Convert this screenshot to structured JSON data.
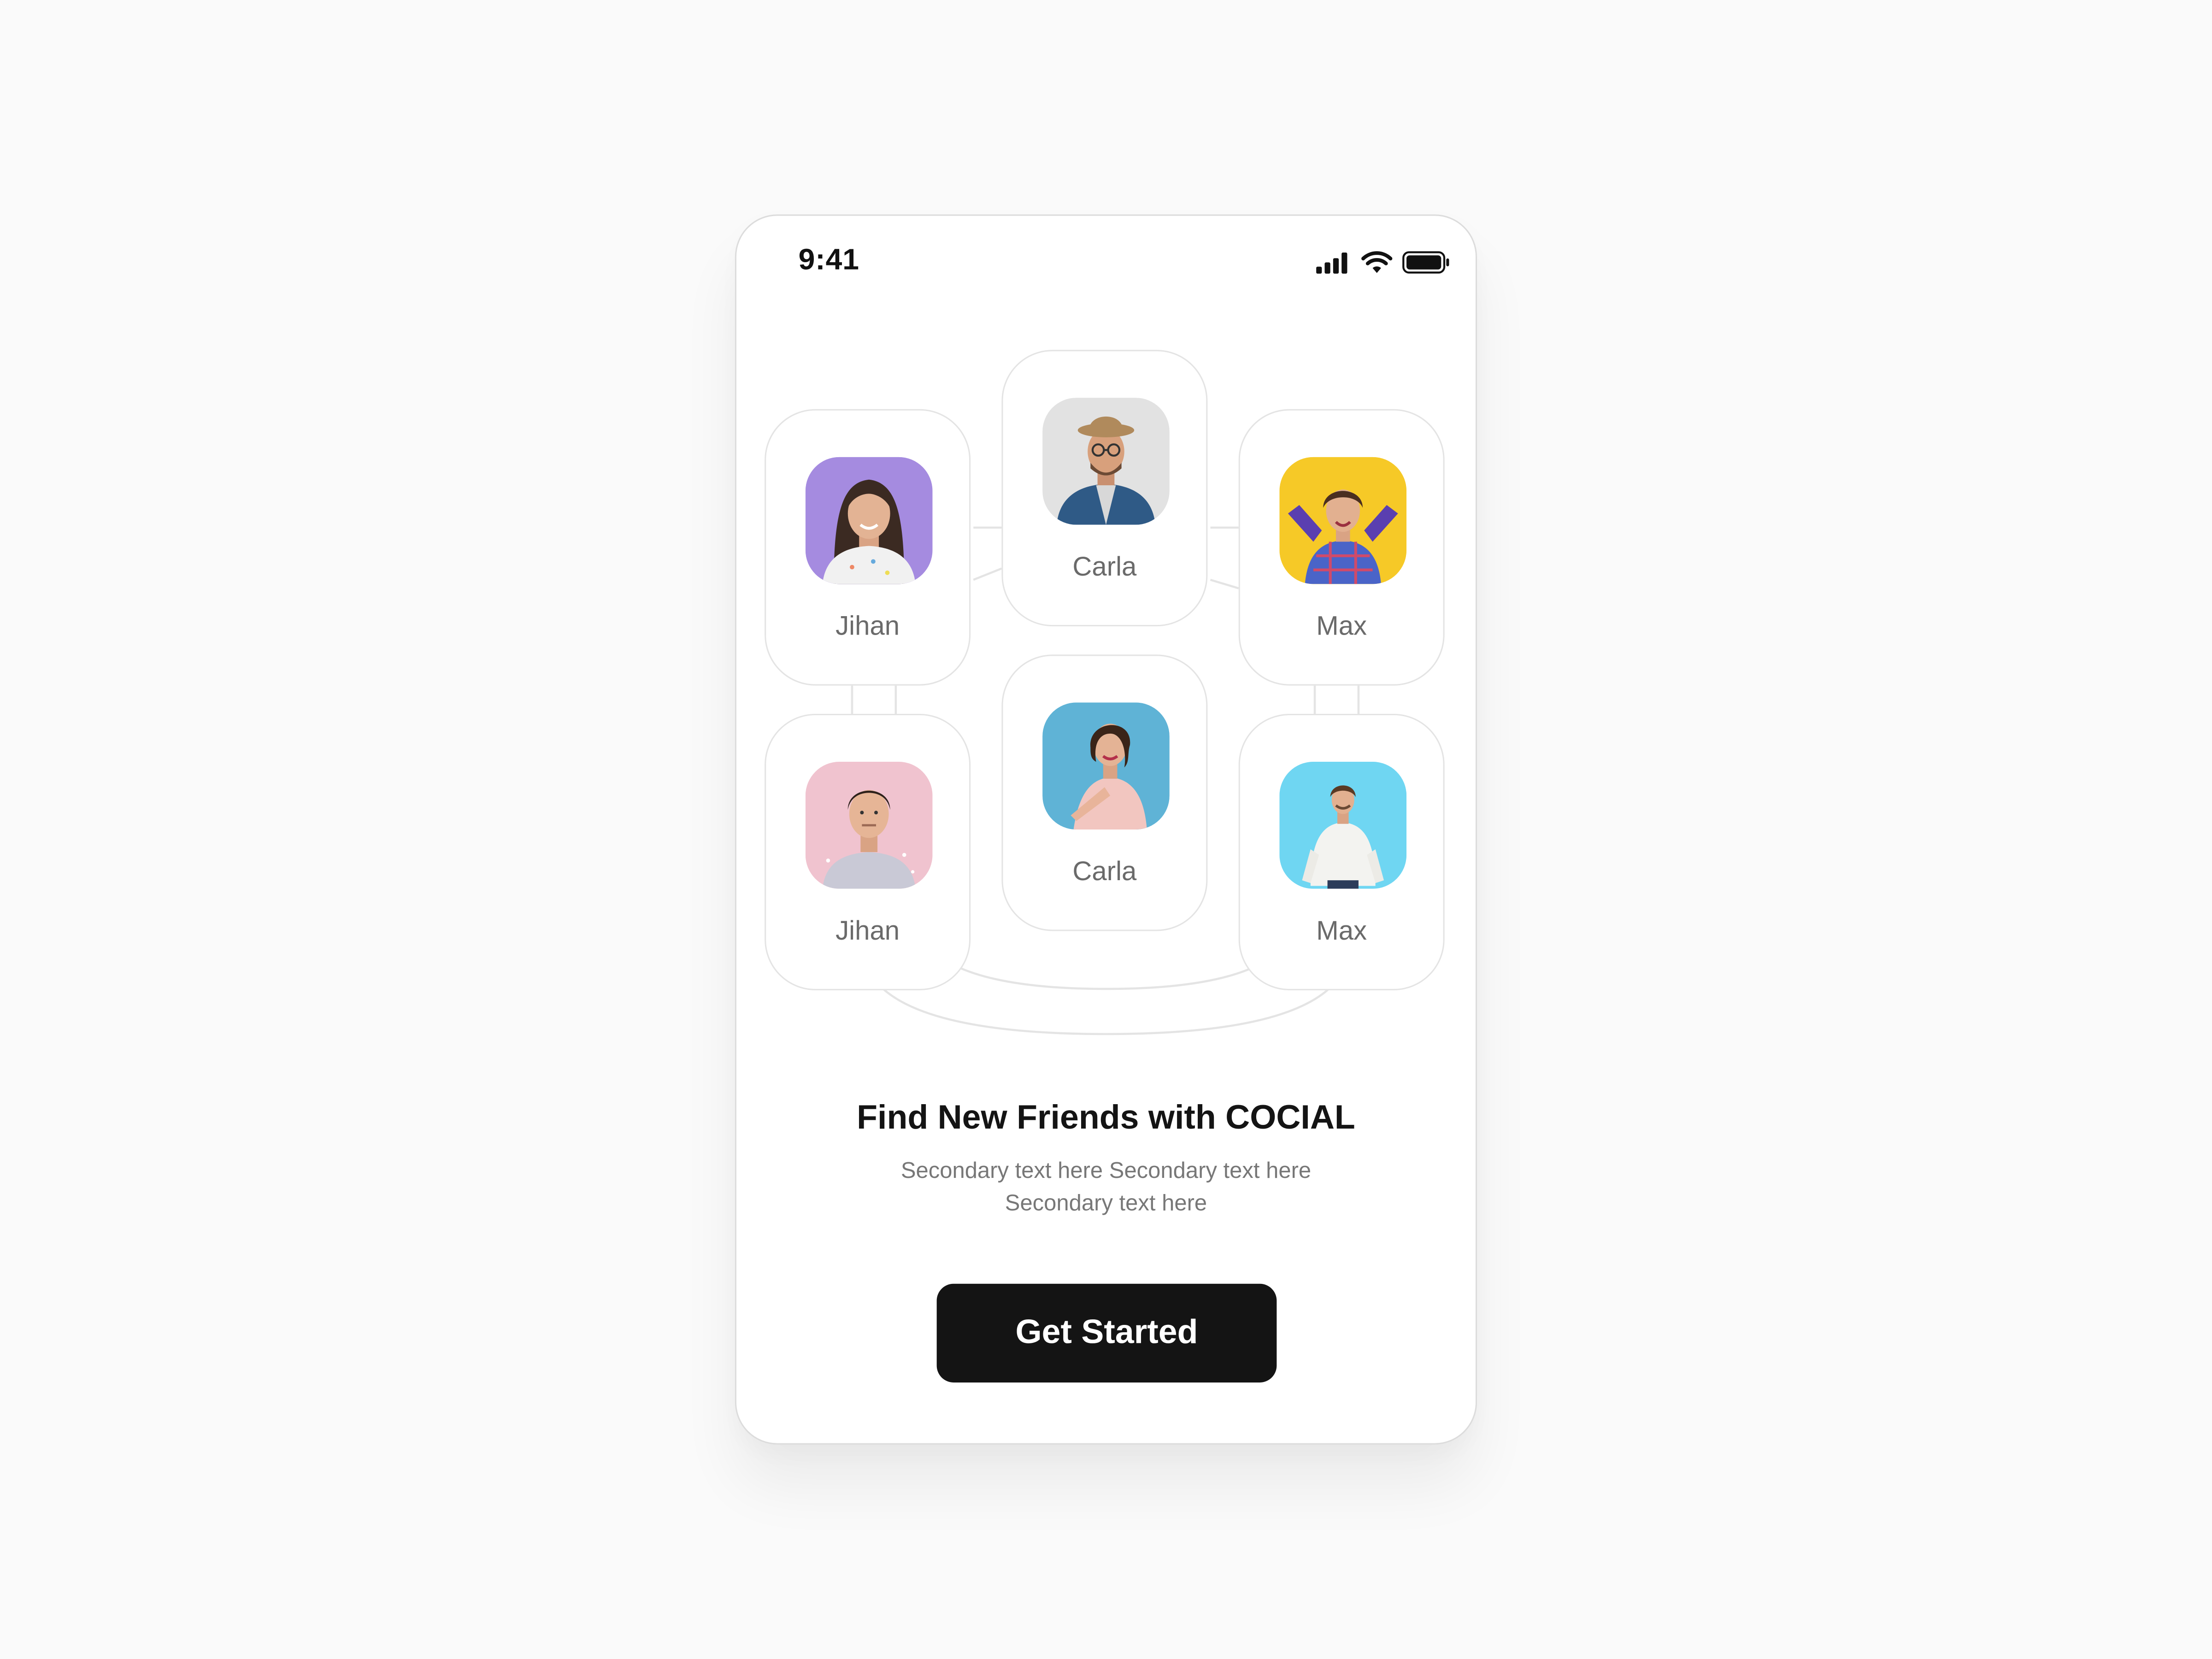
{
  "status_bar": {
    "time": "9:41",
    "icons": [
      "signal-icon",
      "wifi-icon",
      "battery-icon"
    ]
  },
  "friends": [
    {
      "name": "Jihan",
      "avatar_bg": "#a58be0"
    },
    {
      "name": "Carla",
      "avatar_bg": "#e2e2e2"
    },
    {
      "name": "Max",
      "avatar_bg": "#f6c927"
    },
    {
      "name": "Jihan",
      "avatar_bg": "#f0c3cf"
    },
    {
      "name": "Carla",
      "avatar_bg": "#5fb3d6"
    },
    {
      "name": "Max",
      "avatar_bg": "#6fd6f2"
    }
  ],
  "headline": "Find New Friends with COCIAL",
  "subtext": "Secondary text here Secondary text here Secondary text here",
  "cta_label": "Get Started",
  "colors": {
    "background": "#fafafa",
    "card_border": "#e4e4e4",
    "cta_bg": "#141414",
    "cta_text": "#ffffff"
  }
}
